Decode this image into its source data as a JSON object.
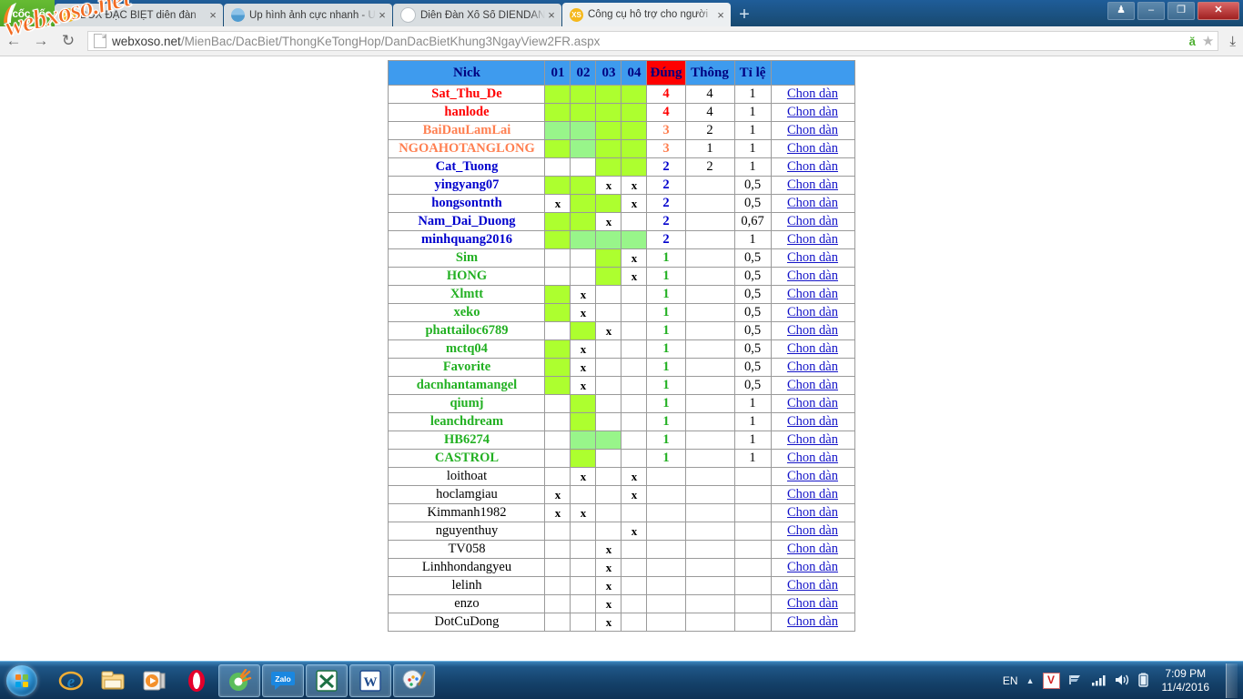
{
  "browser": {
    "brand_label": "cốc cốc",
    "tabs": [
      {
        "label": "BOX ĐẶC BIỆT diễn đàn",
        "favicon": "xs-icon",
        "active": false,
        "close_label": "×"
      },
      {
        "label": "Up hình ảnh cực nhanh - U",
        "favicon": "image-icon",
        "active": false,
        "close_label": "×"
      },
      {
        "label": "Diễn Đàn Xổ Số DIENDAN",
        "favicon": "document-icon",
        "active": false,
        "close_label": "×"
      },
      {
        "label": "Công cụ hỗ trợ cho người",
        "favicon": "xs-icon",
        "active": true,
        "close_label": "×"
      }
    ],
    "new_tab_label": "+",
    "window_controls": {
      "user_label": "♟",
      "minimize_label": "–",
      "restore_label": "❐",
      "close_label": "✕"
    },
    "nav": {
      "back_label": "←",
      "forward_label": "→",
      "reload_label": "↻"
    },
    "url": {
      "host": "webxoso.net",
      "path": "/MienBac/DacBiet/ThongKeTongHop/DanDacBietKhung3NgayView2FR.aspx"
    },
    "omni_icons": {
      "vn_typing_label": "ă",
      "bookmark_label": "★",
      "download_label": "⤓"
    }
  },
  "watermark": {
    "text": "webxoso.net"
  },
  "table": {
    "headers": [
      "Nick",
      "01",
      "02",
      "03",
      "04",
      "Đúng",
      "Thông",
      "Tỉ lệ",
      ""
    ],
    "action_label": "Chon dàn",
    "mark": "x",
    "colors": {
      "header_bg": "#3e9bee",
      "header_text": "#000080",
      "dung_header_bg": "#fe0000",
      "green_bright": "#adff2f",
      "green_pale": "#98f58a",
      "nick_red": "#ff0000",
      "nick_orange": "#ff7f50",
      "nick_blue": "#0000cd",
      "nick_green": "#22b022",
      "nick_black": "#000000",
      "link": "#1414c8"
    },
    "rows": [
      {
        "nick": "Sat_Thu_De",
        "color": "nick_red",
        "cells": [
          "g1",
          "g1",
          "g1",
          "g1"
        ],
        "dung": "4",
        "thong": "4",
        "tile": "1"
      },
      {
        "nick": "hanlode",
        "color": "nick_red",
        "cells": [
          "g1",
          "g1",
          "g1",
          "g1"
        ],
        "dung": "4",
        "thong": "4",
        "tile": "1"
      },
      {
        "nick": "BaiDauLamLai",
        "color": "nick_orange",
        "cells": [
          "g2",
          "g2",
          "g1",
          "g1"
        ],
        "dung": "3",
        "thong": "2",
        "tile": "1"
      },
      {
        "nick": "NGOAHOTANGLONG",
        "color": "nick_orange",
        "cells": [
          "g1",
          "g2",
          "g1",
          "g1"
        ],
        "dung": "3",
        "thong": "1",
        "tile": "1"
      },
      {
        "nick": "Cat_Tuong",
        "color": "nick_blue",
        "cells": [
          "",
          "",
          "g1",
          "g1"
        ],
        "dung": "2",
        "thong": "2",
        "tile": "1"
      },
      {
        "nick": "yingyang07",
        "color": "nick_blue",
        "cells": [
          "g1",
          "g1",
          "x",
          "x"
        ],
        "dung": "2",
        "thong": "",
        "tile": "0,5"
      },
      {
        "nick": "hongsontnth",
        "color": "nick_blue",
        "cells": [
          "x",
          "g1",
          "g1",
          "x"
        ],
        "dung": "2",
        "thong": "",
        "tile": "0,5"
      },
      {
        "nick": "Nam_Dai_Duong",
        "color": "nick_blue",
        "cells": [
          "g1",
          "g1",
          "x",
          ""
        ],
        "dung": "2",
        "thong": "",
        "tile": "0,67"
      },
      {
        "nick": "minhquang2016",
        "color": "nick_blue",
        "cells": [
          "g1",
          "g2",
          "g2",
          "g2"
        ],
        "dung": "2",
        "thong": "",
        "tile": "1"
      },
      {
        "nick": "Sim",
        "color": "nick_green",
        "cells": [
          "",
          "",
          "g1",
          "x"
        ],
        "dung": "1",
        "thong": "",
        "tile": "0,5"
      },
      {
        "nick": "HONG",
        "color": "nick_green",
        "cells": [
          "",
          "",
          "g1",
          "x"
        ],
        "dung": "1",
        "thong": "",
        "tile": "0,5"
      },
      {
        "nick": "Xlmtt",
        "color": "nick_green",
        "cells": [
          "g1",
          "x",
          "",
          ""
        ],
        "dung": "1",
        "thong": "",
        "tile": "0,5"
      },
      {
        "nick": "xeko",
        "color": "nick_green",
        "cells": [
          "g1",
          "x",
          "",
          ""
        ],
        "dung": "1",
        "thong": "",
        "tile": "0,5"
      },
      {
        "nick": "phattailoc6789",
        "color": "nick_green",
        "cells": [
          "",
          "g1",
          "x",
          ""
        ],
        "dung": "1",
        "thong": "",
        "tile": "0,5"
      },
      {
        "nick": "mctq04",
        "color": "nick_green",
        "cells": [
          "g1",
          "x",
          "",
          ""
        ],
        "dung": "1",
        "thong": "",
        "tile": "0,5"
      },
      {
        "nick": "Favorite",
        "color": "nick_green",
        "cells": [
          "g1",
          "x",
          "",
          ""
        ],
        "dung": "1",
        "thong": "",
        "tile": "0,5"
      },
      {
        "nick": "dacnhantamangel",
        "color": "nick_green",
        "cells": [
          "g1",
          "x",
          "",
          ""
        ],
        "dung": "1",
        "thong": "",
        "tile": "0,5"
      },
      {
        "nick": "qiumj",
        "color": "nick_green",
        "cells": [
          "",
          "g1",
          "",
          ""
        ],
        "dung": "1",
        "thong": "",
        "tile": "1"
      },
      {
        "nick": "leanchdream",
        "color": "nick_green",
        "cells": [
          "",
          "g1",
          "",
          ""
        ],
        "dung": "1",
        "thong": "",
        "tile": "1"
      },
      {
        "nick": "HB6274",
        "color": "nick_green",
        "cells": [
          "",
          "g2",
          "g2",
          ""
        ],
        "dung": "1",
        "thong": "",
        "tile": "1"
      },
      {
        "nick": "CASTROL",
        "color": "nick_green",
        "cells": [
          "",
          "g1",
          "",
          ""
        ],
        "dung": "1",
        "thong": "",
        "tile": "1"
      },
      {
        "nick": "loithoat",
        "color": "nick_black",
        "cells": [
          "",
          "x",
          "",
          "x"
        ],
        "dung": "",
        "thong": "",
        "tile": ""
      },
      {
        "nick": "hoclamgiau",
        "color": "nick_black",
        "cells": [
          "x",
          "",
          "",
          "x"
        ],
        "dung": "",
        "thong": "",
        "tile": ""
      },
      {
        "nick": "Kimmanh1982",
        "color": "nick_black",
        "cells": [
          "x",
          "x",
          "",
          ""
        ],
        "dung": "",
        "thong": "",
        "tile": ""
      },
      {
        "nick": "nguyenthuy",
        "color": "nick_black",
        "cells": [
          "",
          "",
          "",
          "x"
        ],
        "dung": "",
        "thong": "",
        "tile": ""
      },
      {
        "nick": "TV058",
        "color": "nick_black",
        "cells": [
          "",
          "",
          "x",
          ""
        ],
        "dung": "",
        "thong": "",
        "tile": ""
      },
      {
        "nick": "Linhhondangyeu",
        "color": "nick_black",
        "cells": [
          "",
          "",
          "x",
          ""
        ],
        "dung": "",
        "thong": "",
        "tile": ""
      },
      {
        "nick": "lelinh",
        "color": "nick_black",
        "cells": [
          "",
          "",
          "x",
          ""
        ],
        "dung": "",
        "thong": "",
        "tile": ""
      },
      {
        "nick": "enzo",
        "color": "nick_black",
        "cells": [
          "",
          "",
          "x",
          ""
        ],
        "dung": "",
        "thong": "",
        "tile": ""
      },
      {
        "nick": "DotCuDong",
        "color": "nick_black",
        "cells": [
          "",
          "",
          "x",
          ""
        ],
        "dung": "",
        "thong": "",
        "tile": ""
      }
    ]
  },
  "taskbar": {
    "start_label": "Start",
    "items": [
      {
        "name": "internet-explorer-icon",
        "open": false
      },
      {
        "name": "file-explorer-icon",
        "open": false
      },
      {
        "name": "media-player-icon",
        "open": false
      },
      {
        "name": "opera-icon",
        "open": false
      },
      {
        "name": "coccoc-icon",
        "open": true
      },
      {
        "name": "zalo-icon",
        "open": true,
        "label": "Zalo"
      },
      {
        "name": "excel-icon",
        "open": true,
        "label": "X"
      },
      {
        "name": "word-icon",
        "open": true,
        "label": "W"
      },
      {
        "name": "paint-icon",
        "open": true
      }
    ],
    "tray": {
      "language": "EN",
      "chevron": "▲",
      "unikey_label": "V",
      "network_label": "network-icon",
      "signal_label": "signal-icon",
      "volume_label": "volume-icon",
      "battery_label": "battery-icon",
      "time": "7:09 PM",
      "date": "11/4/2016"
    }
  }
}
